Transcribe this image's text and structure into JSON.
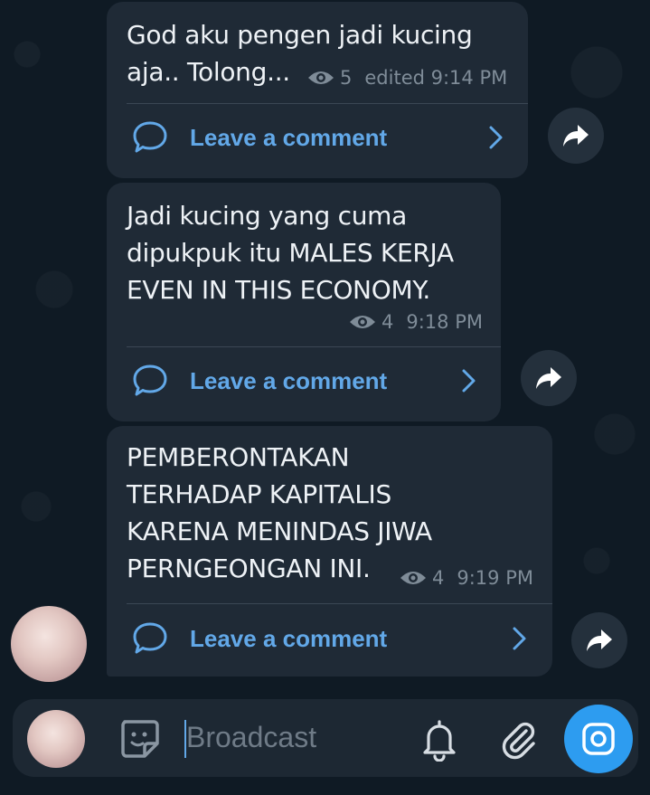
{
  "messages": [
    {
      "text": "God aku pengen jadi kucing\naja.. Tolong...",
      "views": "5",
      "time": "edited 9:14 PM",
      "comment_label": "Leave a comment"
    },
    {
      "text": "Jadi kucing yang cuma\ndipukpuk itu MALES KERJA\nEVEN IN THIS ECONOMY.",
      "views": "4",
      "time": "9:18 PM",
      "comment_label": "Leave a comment"
    },
    {
      "text": "PEMBERONTAKAN\nTERHADAP KAPITALIS\nKARENA MENINDAS JIWA\nPERNGEONGAN INI.",
      "views": "4",
      "time": "9:19 PM",
      "comment_label": "Leave a comment"
    }
  ],
  "composer": {
    "placeholder": "Broadcast"
  },
  "icons": {
    "views": "eye-icon",
    "comment": "comment-bubble-icon",
    "open": "chevron-right-icon",
    "share": "forward-arrow-icon",
    "sticker": "sticker-icon",
    "notify": "bell-icon",
    "attach": "paperclip-icon",
    "camera": "camera-icon"
  },
  "colors": {
    "background": "#0f1a24",
    "bubble": "#1f2a36",
    "accent": "#62a8e8",
    "send_button": "#2d9cf0",
    "meta": "#7f8c98"
  }
}
